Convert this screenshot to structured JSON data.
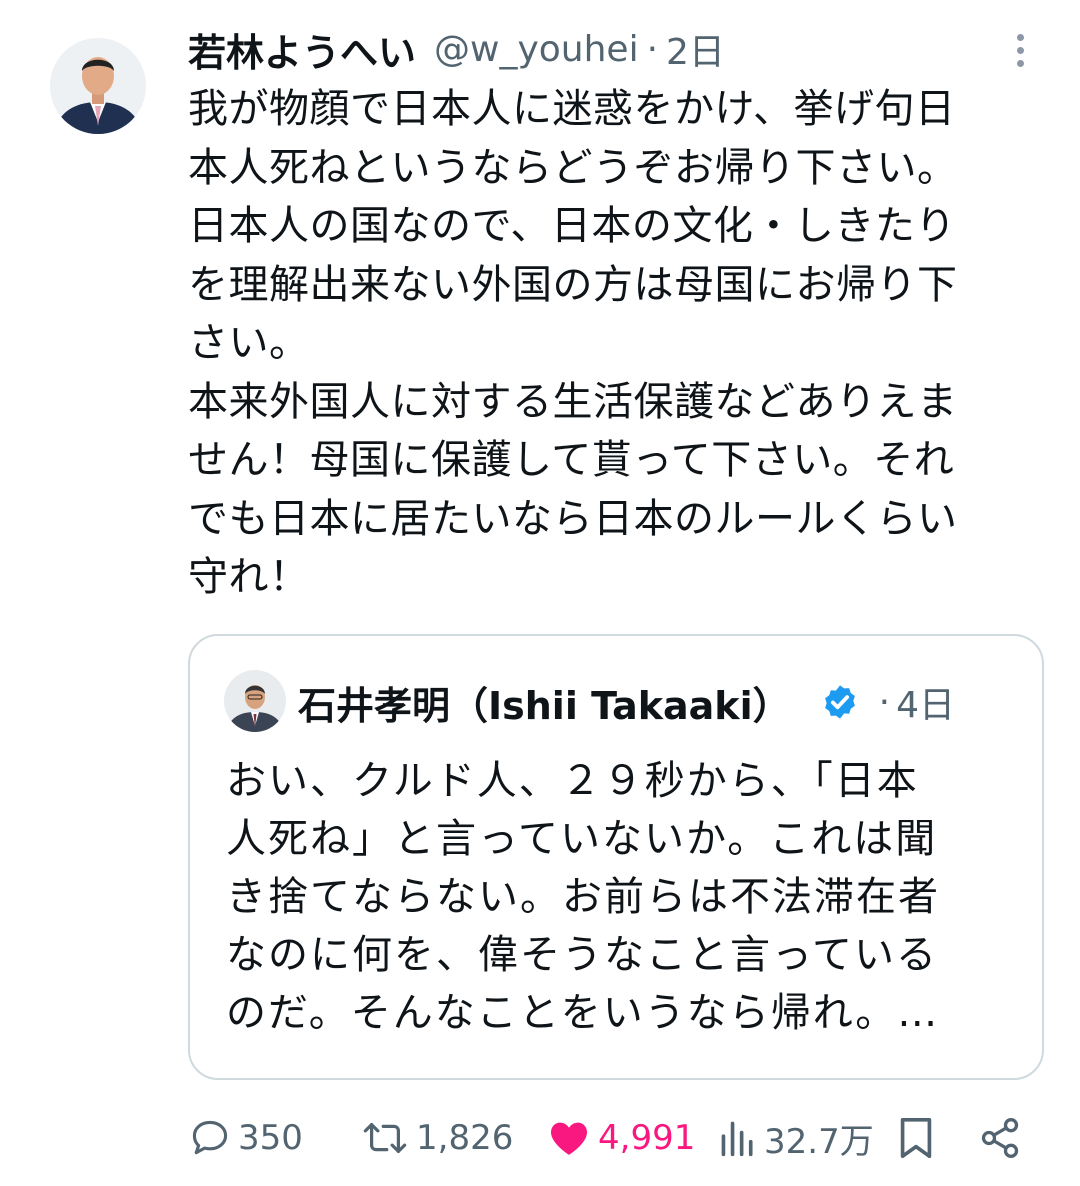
{
  "tweet": {
    "display_name": "若林ようへい",
    "handle": "@w_youhei",
    "separator": "·",
    "time": "2日",
    "body": "我が物顔で日本人に迷惑をかけ、挙げ句日\n本人死ねというならどうぞお帰り下さい。\n日本人の国なので、日本の文化・しきたり\nを理解出来ない外国の方は母国にお帰り下\nさい。\n本来外国人に対する生活保護などありえま\nせん！母国に保護して貰って下さい。それ\nでも日本に居たいなら日本のルールくらい\n守れ！"
  },
  "quote": {
    "display_name": "石井孝明（Ishii Takaaki）",
    "separator": "·",
    "time": "4日",
    "body": "おい、クルド人、２９秒から、「日本\n人死ね」と言っていないか。これは聞\nき捨てならない。お前らは不法滞在者\nなのに何を、偉そうなこと言っている\nのだ。そんなことをいうなら帰れ。…"
  },
  "actions": {
    "replies": "350",
    "retweets": "1,826",
    "likes": "4,991",
    "views": "32.7万"
  },
  "icons": {
    "reply": "speech-bubble-icon",
    "retweet": "retweet-arrows-icon",
    "like": "heart-filled-icon",
    "views": "bar-chart-icon",
    "bookmark": "bookmark-icon",
    "share": "share-nodes-icon",
    "more": "vertical-ellipsis-icon",
    "verified": "verified-badge-icon"
  },
  "colors": {
    "text": "#0f1419",
    "secondary": "#536471",
    "like": "#f91880",
    "verified": "#1d9bf0",
    "border": "#cfd9de"
  }
}
